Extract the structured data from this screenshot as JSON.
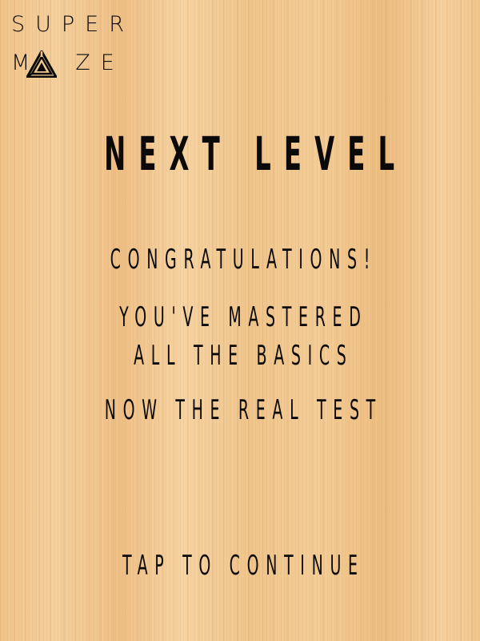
{
  "logo": {
    "line1": "SUPER",
    "line2_before": "M",
    "line2_after": "ZE",
    "mark_icon": "triangle-maze-icon"
  },
  "screen": {
    "title": "NEXT LEVEL",
    "message_congrats": "CONGRATULATIONS!",
    "message_line2": "YOU'VE MASTERED",
    "message_line3": "ALL THE BASICS",
    "message_line4": "NOW THE REAL TEST",
    "tap_prompt": "TAP TO CONTINUE"
  },
  "colors": {
    "text": "#0c0a08",
    "background": "#f1c78f"
  }
}
